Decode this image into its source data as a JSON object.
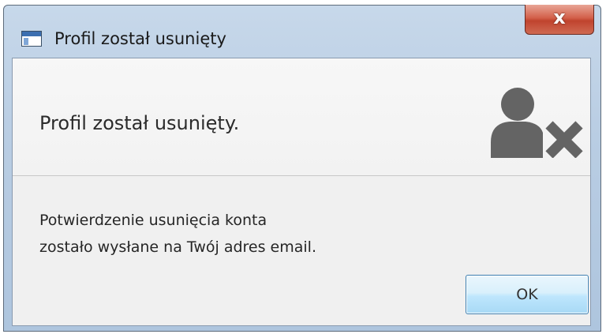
{
  "window": {
    "title": "Profil został usunięty",
    "close_label": "x"
  },
  "dialog": {
    "header_text": "Profil został usunięty.",
    "header_icon": "user-remove-icon",
    "message_lines": [
      "Potwierdzenie usunięcia konta",
      "zostało wysłane na Twój adres email."
    ],
    "ok_label": "OK"
  },
  "colors": {
    "titlebar": "#b9cde3",
    "close_button": "#c0432e",
    "ok_button_border": "#3c7fb1",
    "icon": "#646464"
  }
}
